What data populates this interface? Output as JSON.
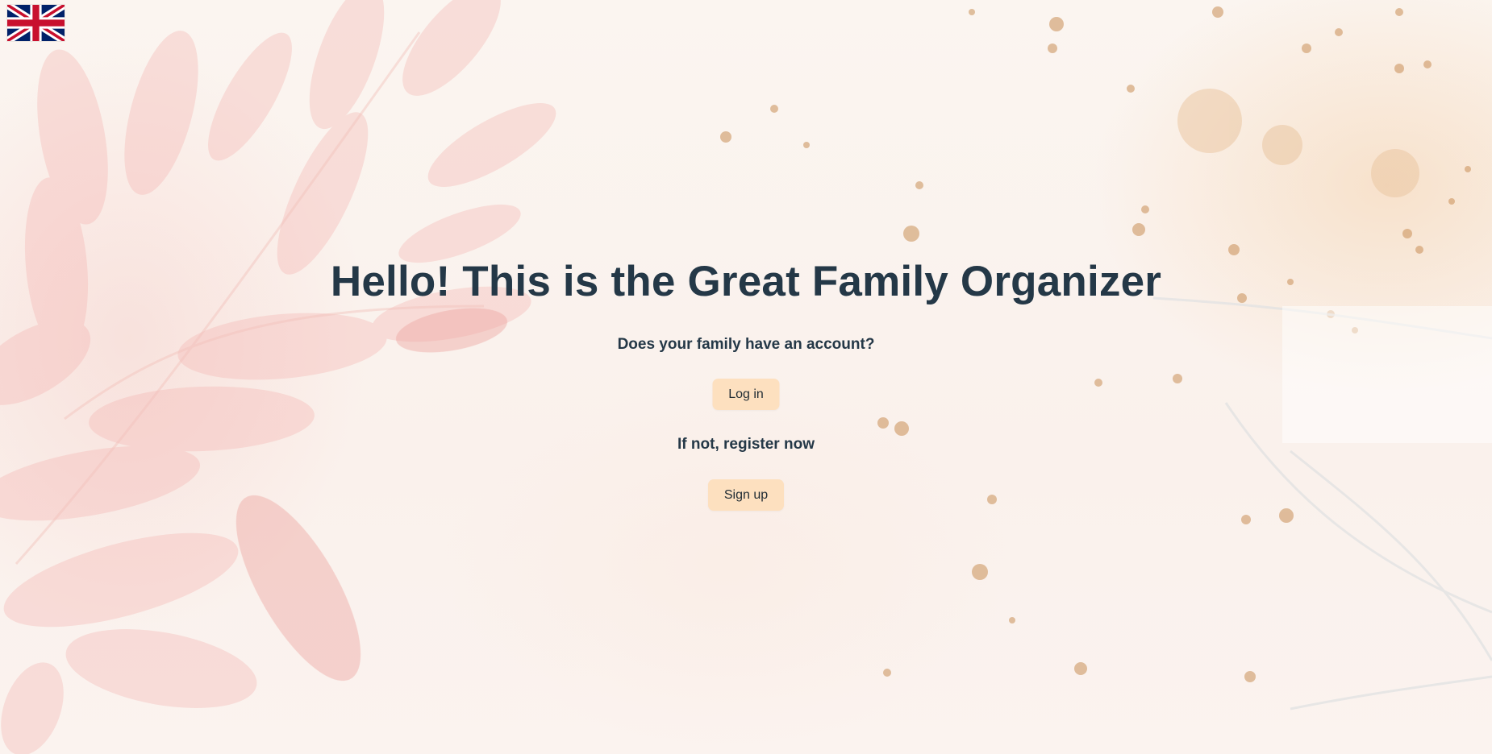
{
  "language": {
    "current": "English",
    "icon": "uk-flag-icon"
  },
  "main": {
    "title": "Hello! This is the Great Family Organizer",
    "account_question": "Does your family have an account?",
    "login_label": "Log in",
    "register_prompt": "If not, register now",
    "signup_label": "Sign up"
  },
  "colors": {
    "text": "#243847",
    "button_bg": "#fde0bf",
    "flag_blue": "#012169",
    "flag_red": "#C8102E"
  }
}
